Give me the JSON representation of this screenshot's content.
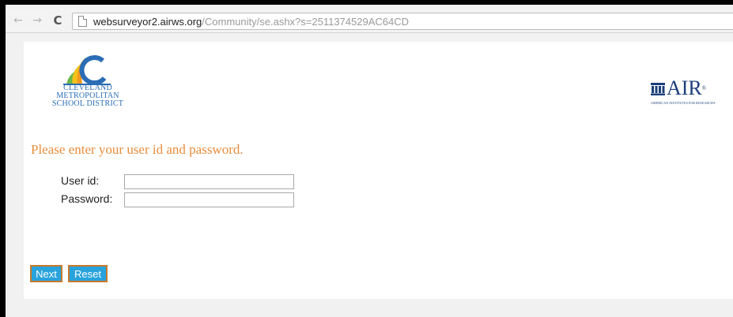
{
  "browser": {
    "url_host": "websurveyor2.airws.org",
    "url_path": "/Community/se.ashx?s=2511374529AC64CD",
    "icons": {
      "back": "arrow-left-icon",
      "forward": "arrow-right-icon",
      "reload": "reload-icon",
      "page": "page-icon"
    }
  },
  "header": {
    "district_logo": {
      "lines": [
        "CLEVELAND",
        "METROPOLITAN",
        "SCHOOL DISTRICT"
      ],
      "colors": {
        "blue": "#2a6db5",
        "orange": "#f39a1e",
        "yellow": "#f6c21a",
        "green": "#6bb84a"
      }
    },
    "air_logo": {
      "word": "AIR",
      "reg": "®",
      "tagline": "AMERICAN INSTITUTES FOR RESEARCH®",
      "color": "#1c3f7a"
    }
  },
  "form": {
    "prompt": "Please enter your user id and password.",
    "user_label": "User id:",
    "user_value": "",
    "password_label": "Password:",
    "password_value": "",
    "next_label": "Next",
    "reset_label": "Reset"
  },
  "colors": {
    "prompt": "#e98d3c",
    "button_bg": "#29a3dc",
    "button_border": "#c77a2c"
  }
}
